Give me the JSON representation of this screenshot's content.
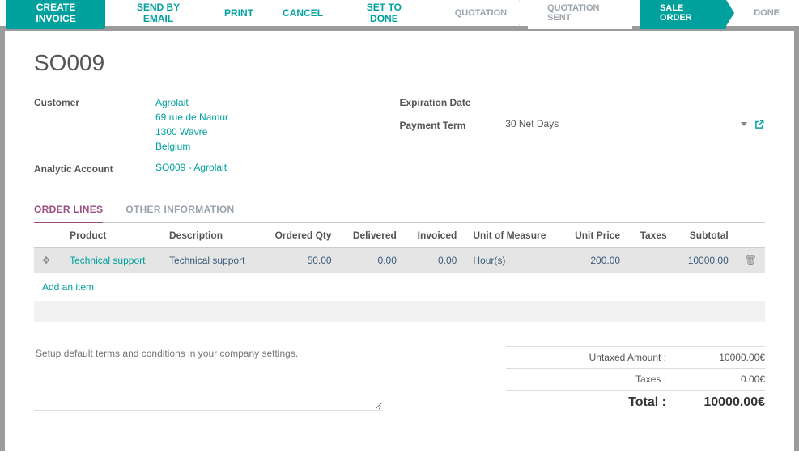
{
  "toolbar": {
    "create_invoice": "CREATE INVOICE",
    "send_email": "SEND BY EMAIL",
    "print": "PRINT",
    "cancel": "CANCEL",
    "set_done": "SET TO DONE"
  },
  "stages": {
    "quotation": "QUOTATION",
    "quotation_sent": "QUOTATION SENT",
    "sale_order": "SALE ORDER",
    "done": "DONE"
  },
  "title": "SO009",
  "labels": {
    "customer": "Customer",
    "analytic": "Analytic Account",
    "expiration": "Expiration Date",
    "payment_term": "Payment Term"
  },
  "customer": {
    "name": "Agrolait",
    "street": "69 rue de Namur",
    "city": "1300 Wavre",
    "country": "Belgium"
  },
  "analytic_account": "SO009 - Agrolait",
  "payment_term": "30 Net Days",
  "tabs": {
    "order_lines": "ORDER LINES",
    "other_info": "OTHER INFORMATION"
  },
  "columns": {
    "product": "Product",
    "description": "Description",
    "ordered_qty": "Ordered Qty",
    "delivered": "Delivered",
    "invoiced": "Invoiced",
    "uom": "Unit of Measure",
    "unit_price": "Unit Price",
    "taxes": "Taxes",
    "subtotal": "Subtotal"
  },
  "lines": [
    {
      "product": "Technical support",
      "description": "Technical support",
      "ordered_qty": "50.00",
      "delivered": "0.00",
      "invoiced": "0.00",
      "uom": "Hour(s)",
      "unit_price": "200.00",
      "taxes": "",
      "subtotal": "10000.00"
    }
  ],
  "add_item": "Add an item",
  "terms_placeholder": "Setup default terms and conditions in your company settings.",
  "totals": {
    "untaxed_label": "Untaxed Amount :",
    "untaxed_val": "10000.00€",
    "taxes_label": "Taxes :",
    "taxes_val": "0.00€",
    "total_label": "Total :",
    "total_val": "10000.00€"
  }
}
